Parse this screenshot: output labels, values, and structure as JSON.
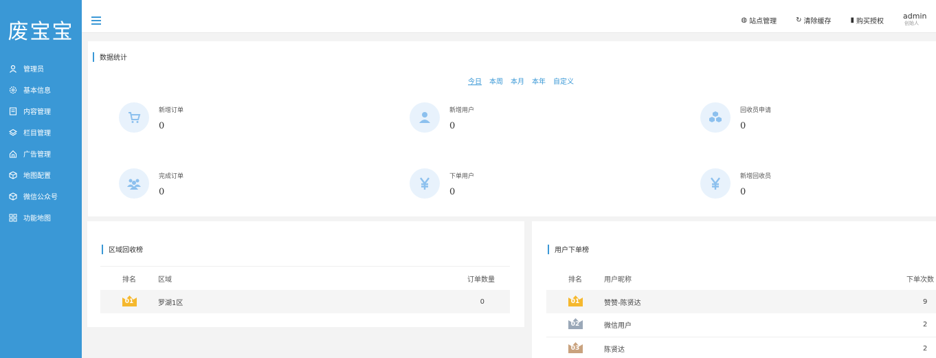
{
  "brand": {
    "logo_text": "废宝宝"
  },
  "sidebar": {
    "items": [
      {
        "label": "管理员",
        "icon": "user-icon"
      },
      {
        "label": "基本信息",
        "icon": "gear-icon"
      },
      {
        "label": "内容管理",
        "icon": "document-icon"
      },
      {
        "label": "栏目管理",
        "icon": "layers-icon"
      },
      {
        "label": "广告管理",
        "icon": "home-icon"
      },
      {
        "label": "地图配置",
        "icon": "cube-icon"
      },
      {
        "label": "微信公众号",
        "icon": "cube-icon"
      },
      {
        "label": "功能地图",
        "icon": "grid-icon"
      }
    ]
  },
  "topbar": {
    "site_manage": "站点管理",
    "clear_cache": "清除缓存",
    "buy_license": "购买授权",
    "user_name": "admin",
    "user_role": "创始人"
  },
  "stats": {
    "title": "数据统计",
    "filters": [
      "今日",
      "本周",
      "本月",
      "本年",
      "自定义"
    ],
    "active_filter": "今日",
    "cards": [
      {
        "label": "新增订单",
        "value": "0",
        "icon": "cart-icon"
      },
      {
        "label": "新增用户",
        "value": "0",
        "icon": "user-icon"
      },
      {
        "label": "回收员申请",
        "value": "0",
        "icon": "cubes-icon"
      },
      {
        "label": "完成订单",
        "value": "0",
        "icon": "users-icon"
      },
      {
        "label": "下单用户",
        "value": "0",
        "icon": "yen-icon"
      },
      {
        "label": "新增回收员",
        "value": "0",
        "icon": "yen-icon"
      }
    ]
  },
  "region_rank": {
    "title": "区域回收榜",
    "columns": [
      "排名",
      "区域",
      "订单数量"
    ],
    "rows": [
      {
        "rank": "01",
        "name": "罗湖1区",
        "count": "0"
      }
    ]
  },
  "user_rank": {
    "title": "用户下单榜",
    "columns": [
      "排名",
      "用户昵称",
      "下单次数"
    ],
    "rows": [
      {
        "rank": "01",
        "name": "赞赞-陈贤达",
        "count": "9"
      },
      {
        "rank": "02",
        "name": "微信用户",
        "count": "2"
      },
      {
        "rank": "03",
        "name": "陈贤达",
        "count": "2"
      }
    ]
  },
  "colors": {
    "primary": "#3a98d6",
    "gold": "#f5b82e",
    "silver": "#9aa8b8",
    "bronze": "#c9a27e",
    "icon_bg": "#e8f2fc"
  }
}
